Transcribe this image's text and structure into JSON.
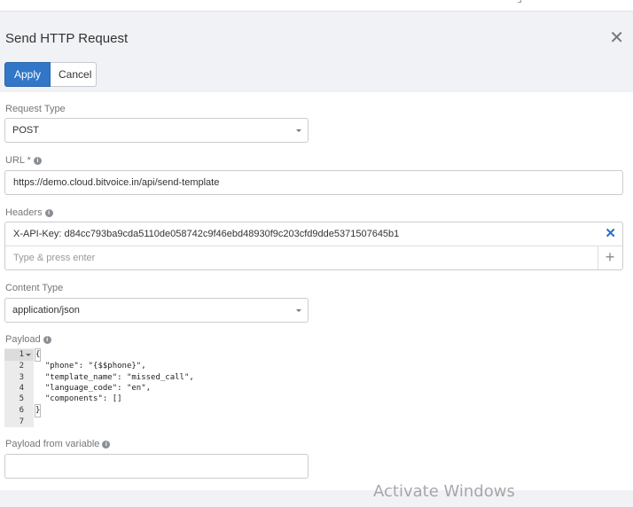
{
  "dialog": {
    "title": "Send HTTP Request",
    "close_symbol": "✕",
    "apply_label": "Apply",
    "cancel_label": "Cancel"
  },
  "request_type": {
    "label": "Request Type",
    "value": "POST"
  },
  "url": {
    "label": "URL *",
    "value": "https://demo.cloud.bitvoice.in/api/send-template"
  },
  "headers": {
    "label": "Headers",
    "items": [
      {
        "value": "X-API-Key: d84cc793ba9cda5110de058742c9f46ebd48930f9c203cfd9dde5371507645b1"
      }
    ],
    "remove_symbol": "✕",
    "new_placeholder": "Type & press enter",
    "add_symbol": "+"
  },
  "content_type": {
    "label": "Content Type",
    "value": "application/json"
  },
  "payload": {
    "label": "Payload",
    "line_numbers": [
      "1",
      "2",
      "3",
      "4",
      "5",
      "6",
      "7"
    ],
    "lines": [
      "{",
      "  \"phone\": \"{$$phone}\",",
      "  \"template_name\": \"missed_call\",",
      "  \"language_code\": \"en\",",
      "  \"components\": []",
      "}",
      ""
    ]
  },
  "payload_from_variable": {
    "label": "Payload from variable",
    "value": ""
  },
  "info_icon": "i",
  "watermark": "Activate Windows"
}
